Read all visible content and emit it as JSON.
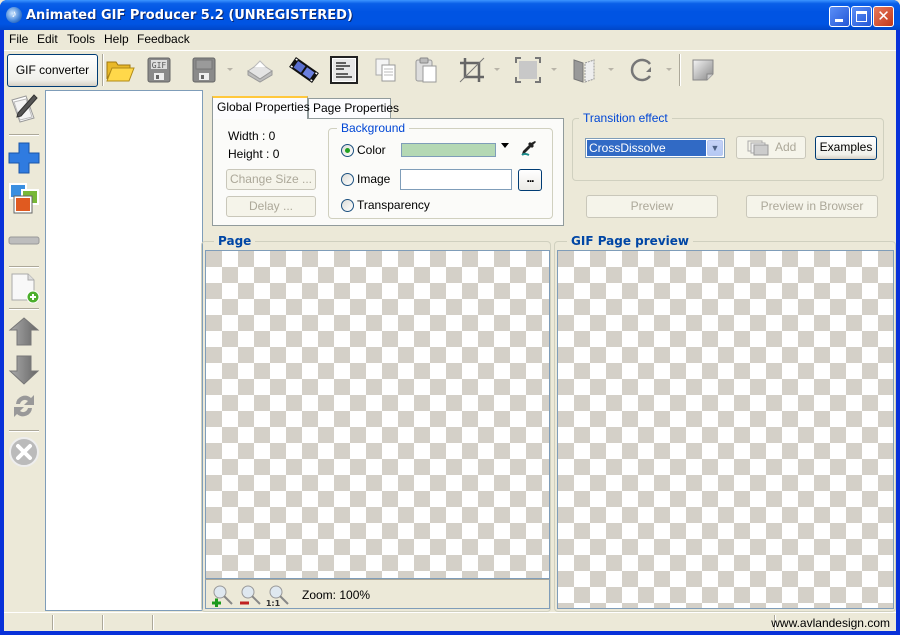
{
  "window": {
    "title": "Animated GIF Producer 5.2 (UNREGISTERED)",
    "controls": {
      "minimize": "minimize",
      "maximize": "maximize",
      "close": "✕"
    }
  },
  "menu": [
    "File",
    "Edit",
    "Tools",
    "Help",
    "Feedback"
  ],
  "toolbar": {
    "gif_converter_label": "GIF converter",
    "buttons": [
      {
        "name": "open-folder-icon",
        "label": "Open"
      },
      {
        "name": "save-gif-icon",
        "label": "Save GIF"
      },
      {
        "name": "save-icon",
        "label": "Save"
      },
      {
        "name": "print-icon",
        "label": "Print"
      },
      {
        "name": "film-icon",
        "label": "Movie"
      },
      {
        "name": "document-icon",
        "label": "Document"
      },
      {
        "name": "copy-icon",
        "label": "Copy"
      },
      {
        "name": "paste-icon",
        "label": "Paste"
      },
      {
        "name": "crop-icon",
        "label": "Crop"
      },
      {
        "name": "resize-icon",
        "label": "Resize"
      },
      {
        "name": "flip-icon",
        "label": "Flip"
      },
      {
        "name": "rotate-icon",
        "label": "Rotate"
      },
      {
        "name": "page-icon",
        "label": "Page"
      }
    ],
    "gif_badge": "GIF"
  },
  "left_toolbar": [
    {
      "name": "edit-pages-icon"
    },
    {
      "name": "add-icon"
    },
    {
      "name": "add-images-icon"
    },
    {
      "name": "remove-icon"
    },
    {
      "name": "new-page-icon"
    },
    {
      "name": "move-up-icon"
    },
    {
      "name": "move-down-icon"
    },
    {
      "name": "refresh-icon"
    },
    {
      "name": "delete-icon"
    }
  ],
  "properties": {
    "tabs": [
      {
        "label": "Global Properties",
        "active": true
      },
      {
        "label": "Page Properties",
        "active": false
      }
    ],
    "width_label": "Width : 0",
    "height_label": "Height : 0",
    "change_size_label": "Change Size ...",
    "delay_label": "Delay ...",
    "background": {
      "title": "Background",
      "options": [
        {
          "label": "Color",
          "checked": true
        },
        {
          "label": "Image",
          "checked": false
        },
        {
          "label": "Transparency",
          "checked": false
        }
      ],
      "color_value": "#b4d8b4",
      "image_path": "",
      "browse_label": "..."
    }
  },
  "transition": {
    "title": "Transition effect",
    "selected": "CrossDissolve",
    "add_label": "Add",
    "examples_label": "Examples",
    "preview_label": "Preview",
    "preview_browser_label": "Preview in Browser"
  },
  "page_panel": {
    "title": "Page",
    "zoom_text": "Zoom: 100%",
    "zoom_reset_label": "1:1"
  },
  "preview_panel": {
    "title": "GIF Page preview"
  },
  "statusbar": {
    "website": "www.avlandesign.com"
  }
}
